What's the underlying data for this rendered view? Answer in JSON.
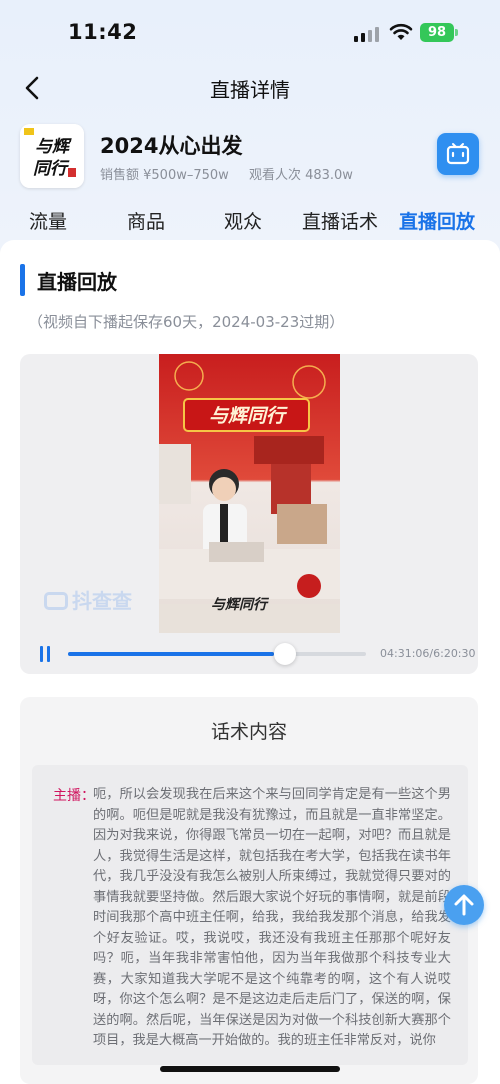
{
  "status_bar": {
    "time": "11:42",
    "battery": "98"
  },
  "nav": {
    "title": "直播详情"
  },
  "room": {
    "logo_text": "与辉同行",
    "title": "2024从心出发",
    "sales": "销售额 ¥500w–750w",
    "views": "观看人次 483.0w"
  },
  "tabs": [
    {
      "label": "流量"
    },
    {
      "label": "商品"
    },
    {
      "label": "观众"
    },
    {
      "label": "直播话术"
    },
    {
      "label": "直播回放"
    }
  ],
  "replay": {
    "section_title": "直播回放",
    "note": "（视频自下播起保存60天，2024-03-23过期）",
    "watermark": "抖查查",
    "progress": 0.69,
    "time": "04:31:06/6:20:30"
  },
  "script": {
    "title": "话术内容",
    "speaker": "主播：",
    "text": "呃，所以会发现我在后来这个来与回同学肯定是有一些这个男的啊。呃但是呢就是我没有犹豫过，而且就是一直非常坚定。因为对我来说，你得跟飞常员一切在一起啊，对吧？而且就是人，我觉得生活是这样，就包括我在考大学，包括我在读书年代，我几乎没没有我怎么被别人所束缚过，我就觉得只要对的事情我就要坚持做。然后跟大家说个好玩的事情啊，就是前段时间我那个高中班主任啊，给我，我给我发那个消息，给我发个好友验证。哎，我说哎，我还没有我班主任那那个呢好友吗？呃，当年我非常害怕他，因为当年我做那个科技专业大赛，大家知道我大学呢不是这个纯靠考的啊，这个有人说哎呀，你这个怎么啊？是不是这边走后走后门了，保送的啊，保送的啊。然后呢，当年保送是因为对做一个科技创新大赛那个项目，我是大概高一开始做的。我的班主任非常反对，说你"
  }
}
